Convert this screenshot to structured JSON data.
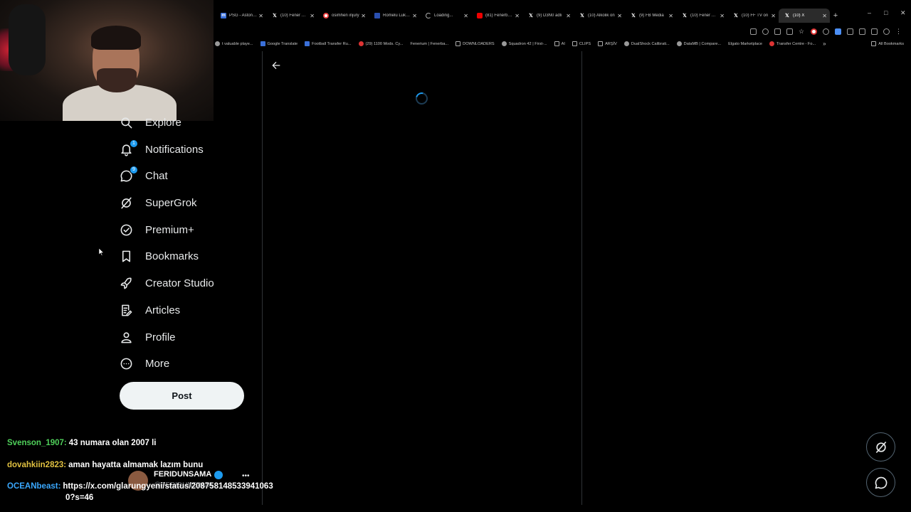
{
  "browser": {
    "tabs": [
      {
        "favicon": "m",
        "title": "PSG - Aston Villa"
      },
      {
        "favicon": "x",
        "title": "(10) Fener Ajans"
      },
      {
        "favicon": "g",
        "title": "osimhen injury"
      },
      {
        "favicon": "r",
        "title": "Romelu Lukaku"
      },
      {
        "favicon": "ld",
        "title": "Loading..."
      },
      {
        "favicon": "yt",
        "title": "(81) Fenerbahçe"
      },
      {
        "favicon": "x",
        "title": "(9) D3N0 adlı"
      },
      {
        "favicon": "x",
        "title": "(10) Alkolik on"
      },
      {
        "favicon": "x",
        "title": "(9) FB Media"
      },
      {
        "favicon": "x",
        "title": "(10) Fener Ajans"
      },
      {
        "favicon": "x",
        "title": "(10) FF TV on"
      },
      {
        "favicon": "x",
        "title": "(10) X",
        "active": true
      }
    ],
    "bookmarks": [
      {
        "icon": "gray",
        "label": "t valuable playe..."
      },
      {
        "icon": "blue",
        "label": "Google Translate"
      },
      {
        "icon": "blue",
        "label": "Football Transfer Ru..."
      },
      {
        "icon": "red",
        "label": "(29) 1100 Mods. Cy..."
      },
      {
        "icon": "none",
        "label": "Fenerium | Fenerba..."
      },
      {
        "icon": "fold",
        "label": "DOWNLOADERS"
      },
      {
        "icon": "gray",
        "label": "Squadron 42 | First-..."
      },
      {
        "icon": "fold",
        "label": "AI"
      },
      {
        "icon": "fold",
        "label": "CLIPS"
      },
      {
        "icon": "fold",
        "label": "ARŞİV"
      },
      {
        "icon": "gray",
        "label": "DualShock Calibrati..."
      },
      {
        "icon": "gray",
        "label": "DataMB | Compare..."
      },
      {
        "icon": "none",
        "label": "Elgato Marketplace"
      },
      {
        "icon": "red",
        "label": "Transfer Centre - Fo..."
      }
    ],
    "all_bookmarks": "All Bookmarks"
  },
  "nav": {
    "items": [
      {
        "name": "explore",
        "icon": "search-icon",
        "label": "Explore"
      },
      {
        "name": "notifications",
        "icon": "bell-icon",
        "label": "Notifications",
        "badge": "1"
      },
      {
        "name": "chat",
        "icon": "chat-icon",
        "label": "Chat",
        "badge": "9"
      },
      {
        "name": "supergrok",
        "icon": "grok-icon",
        "label": "SuperGrok"
      },
      {
        "name": "premium",
        "icon": "verified-icon",
        "label": "Premium+"
      },
      {
        "name": "bookmarks",
        "icon": "bookmark-icon",
        "label": "Bookmarks"
      },
      {
        "name": "creator-studio",
        "icon": "rocket-icon",
        "label": "Creator Studio"
      },
      {
        "name": "articles",
        "icon": "article-icon",
        "label": "Articles"
      },
      {
        "name": "profile",
        "icon": "person-icon",
        "label": "Profile"
      },
      {
        "name": "more",
        "icon": "more-circle-icon",
        "label": "More"
      }
    ],
    "post_label": "Post"
  },
  "account": {
    "name": "FERIDUNSAMA",
    "handle": "@FERIDUNSAMA"
  },
  "chat": {
    "messages": [
      {
        "user": "Svenson_1907:",
        "color": "#4fd05a",
        "text": "43 numara olan 2007 li"
      },
      {
        "user": "dovahkiin2823:",
        "color": "#e0c040",
        "text": "aman hayatta almamak lazım bunu"
      },
      {
        "user": "OCEANbeast:",
        "color": "#3aa8ff",
        "text": "https://x.com/glarungyeni/status/208758148533941063"
      }
    ],
    "continuation": "0?s=46"
  },
  "colors": {
    "accent": "#1d9bf0",
    "background": "#000000",
    "text": "#e7e9ea",
    "divider": "#2f3336"
  }
}
